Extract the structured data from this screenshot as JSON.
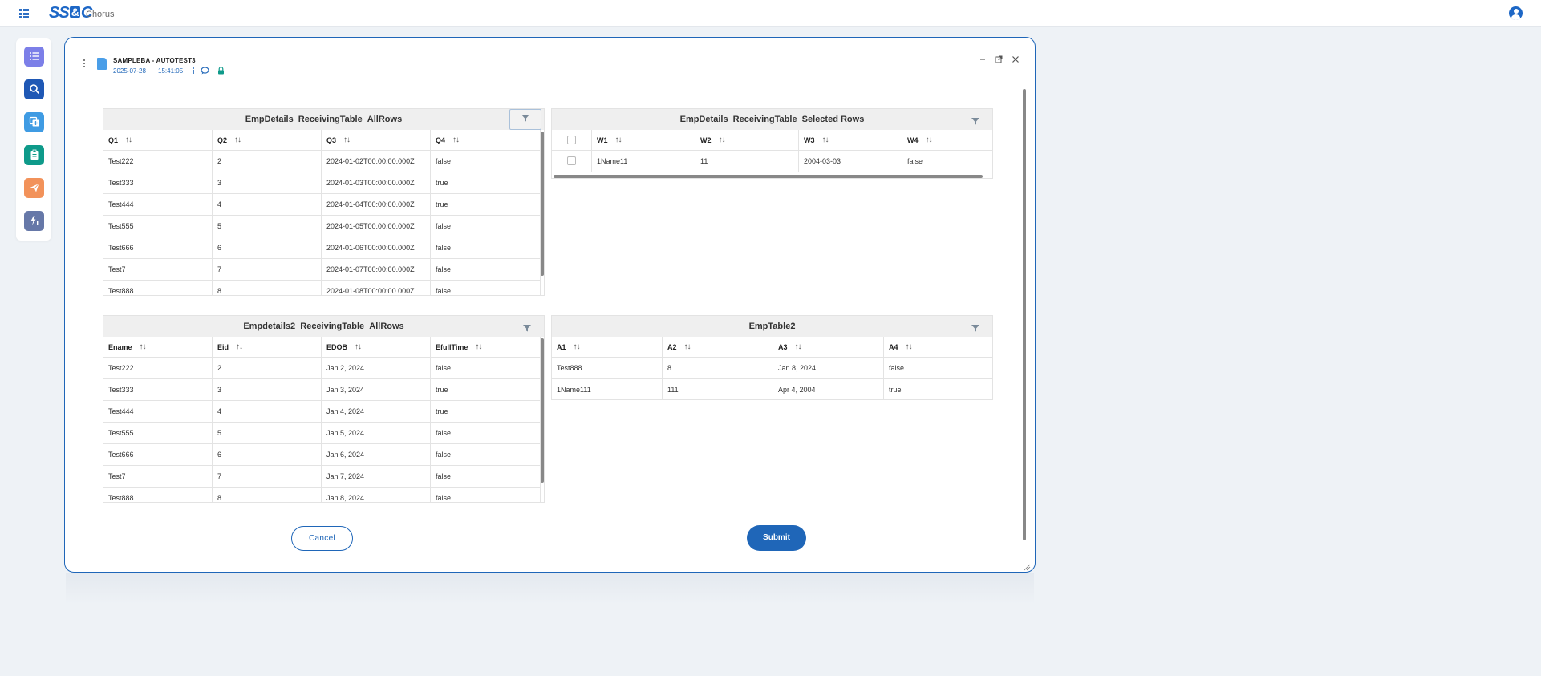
{
  "app": {
    "name": "Chorus",
    "logo_text": "SS&C"
  },
  "rail": {
    "items": [
      {
        "icon": "list-icon",
        "color": "#7c7fe8"
      },
      {
        "icon": "search-icon",
        "color": "#1f58b5"
      },
      {
        "icon": "copy-add-icon",
        "color": "#3f9be3"
      },
      {
        "icon": "clipboard-icon",
        "color": "#0e9a8a"
      },
      {
        "icon": "send-icon",
        "color": "#f2925a"
      },
      {
        "icon": "flash-one-icon",
        "color": "#6678a8"
      }
    ]
  },
  "dialog": {
    "title": "SAMPLEBA - AUTOTEST3",
    "date": "2025-07-28",
    "time": "15:41:05"
  },
  "tables": {
    "t1": {
      "title": "EmpDetails_ReceivingTable_AllRows",
      "columns": [
        "Q1",
        "Q2",
        "Q3",
        "Q4"
      ],
      "rows": [
        [
          "Test222",
          "2",
          "2024-01-02T00:00:00.000Z",
          "false"
        ],
        [
          "Test333",
          "3",
          "2024-01-03T00:00:00.000Z",
          "true"
        ],
        [
          "Test444",
          "4",
          "2024-01-04T00:00:00.000Z",
          "true"
        ],
        [
          "Test555",
          "5",
          "2024-01-05T00:00:00.000Z",
          "false"
        ],
        [
          "Test666",
          "6",
          "2024-01-06T00:00:00.000Z",
          "false"
        ],
        [
          "Test7",
          "7",
          "2024-01-07T00:00:00.000Z",
          "false"
        ],
        [
          "Test888",
          "8",
          "2024-01-08T00:00:00.000Z",
          "false"
        ]
      ]
    },
    "t2": {
      "title": "EmpDetails_ReceivingTable_Selected Rows",
      "columns": [
        "W1",
        "W2",
        "W3",
        "W4"
      ],
      "rows": [
        [
          "1Name11",
          "11",
          "2004-03-03",
          "false"
        ]
      ]
    },
    "t3": {
      "title": "Empdetails2_ReceivingTable_AllRows",
      "columns": [
        "Ename",
        "Eid",
        "EDOB",
        "EfullTime"
      ],
      "rows": [
        [
          "Test222",
          "2",
          "Jan 2, 2024",
          "false"
        ],
        [
          "Test333",
          "3",
          "Jan 3, 2024",
          "true"
        ],
        [
          "Test444",
          "4",
          "Jan 4, 2024",
          "true"
        ],
        [
          "Test555",
          "5",
          "Jan 5, 2024",
          "false"
        ],
        [
          "Test666",
          "6",
          "Jan 6, 2024",
          "false"
        ],
        [
          "Test7",
          "7",
          "Jan 7, 2024",
          "false"
        ],
        [
          "Test888",
          "8",
          "Jan 8, 2024",
          "false"
        ]
      ]
    },
    "t4": {
      "title": "EmpTable2",
      "columns": [
        "A1",
        "A2",
        "A3",
        "A4"
      ],
      "rows": [
        [
          "Test888",
          "8",
          "Jan 8, 2024",
          "false"
        ],
        [
          "1Name111",
          "111",
          "Apr 4, 2004",
          "true"
        ]
      ]
    }
  },
  "actions": {
    "cancel_label": "Cancel",
    "submit_label": "Submit"
  }
}
